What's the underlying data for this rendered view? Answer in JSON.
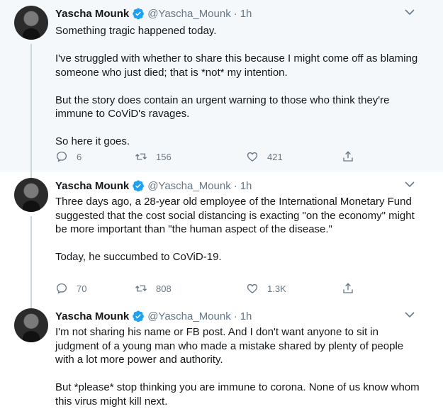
{
  "tweets": [
    {
      "name": "Yascha Mounk",
      "handle": "@Yascha_Mounk",
      "time": "1h",
      "text": "Something tragic happened today.\n\nI've struggled with whether to share this because I might come off as blaming someone who just died; that is *not* my intention.\n\nBut the story does contain an urgent warning to those who think they're immune to CoViD's ravages.\n\nSo here it goes.",
      "replies": "6",
      "retweets": "156",
      "likes": "421"
    },
    {
      "name": "Yascha Mounk",
      "handle": "@Yascha_Mounk",
      "time": "1h",
      "text": "Three days ago, a 28-year old employee of the International Monetary Fund suggested that the cost social distancing is exacting \"on the economy\" might be more important than \"the human aspect of the disease.\"\n\nToday, he succumbed to CoViD-19.",
      "replies": "70",
      "retweets": "808",
      "likes": "1.3K"
    },
    {
      "name": "Yascha Mounk",
      "handle": "@Yascha_Mounk",
      "time": "1h",
      "text": "I'm not sharing his name or FB post. And I don't want anyone to sit in judgment of a young man who made a mistake shared by plenty of people with a lot more power and authority.\n\nBut *please* stop thinking you are immune to corona. None of us know whom this virus might kill next."
    }
  ],
  "separator": "·",
  "colors": {
    "verified": "#1da1f2",
    "muted": "#657786",
    "thread_line": "#ccd6dd"
  },
  "icons": [
    "verified-badge-icon",
    "chevron-down-icon",
    "reply-icon",
    "retweet-icon",
    "like-icon",
    "share-icon"
  ]
}
